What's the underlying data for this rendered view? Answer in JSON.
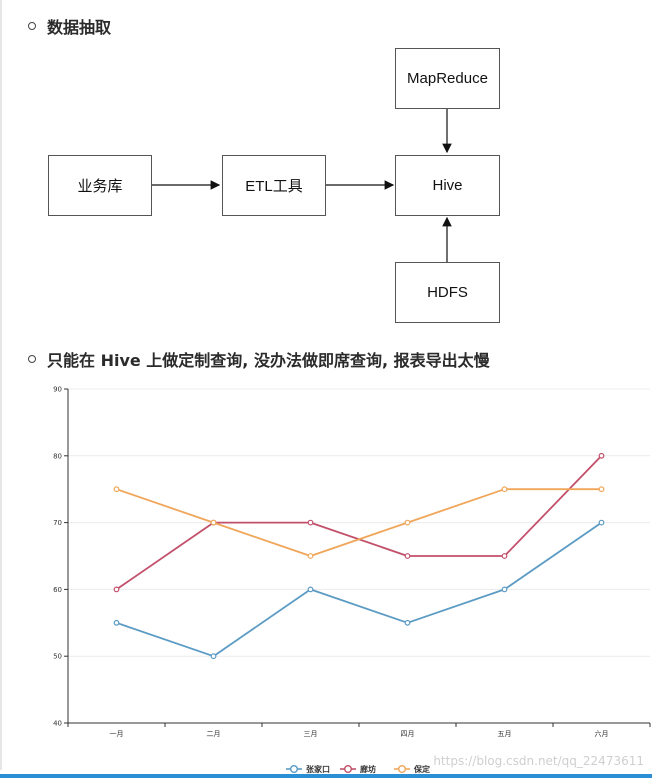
{
  "section1": {
    "heading": "数据抽取"
  },
  "diagram": {
    "nodes": {
      "source": "业务库",
      "etl": "ETL工具",
      "hive": "Hive",
      "mapreduce": "MapReduce",
      "hdfs": "HDFS"
    }
  },
  "section2": {
    "heading": "只能在 Hive 上做定制查询, 没办法做即席查询, 报表导出太慢"
  },
  "chart_data": {
    "type": "line",
    "categories": [
      "一月",
      "二月",
      "三月",
      "四月",
      "五月",
      "六月"
    ],
    "ylim": [
      40,
      90
    ],
    "yticks": [
      "40",
      "50",
      "60",
      "70",
      "80",
      "90"
    ],
    "grid": true,
    "legend_position": "bottom-center",
    "series": [
      {
        "name": "张家口",
        "color": "#5b9bc4",
        "values": [
          55,
          50,
          60,
          55,
          60,
          70
        ]
      },
      {
        "name": "廊坊",
        "color": "#c2506a",
        "values": [
          60,
          70,
          70,
          65,
          65,
          80
        ]
      },
      {
        "name": "保定",
        "color": "#f0a65a",
        "values": [
          75,
          70,
          65,
          70,
          75,
          75
        ]
      }
    ]
  },
  "watermark": "https://blog.csdn.net/qq_22473611"
}
